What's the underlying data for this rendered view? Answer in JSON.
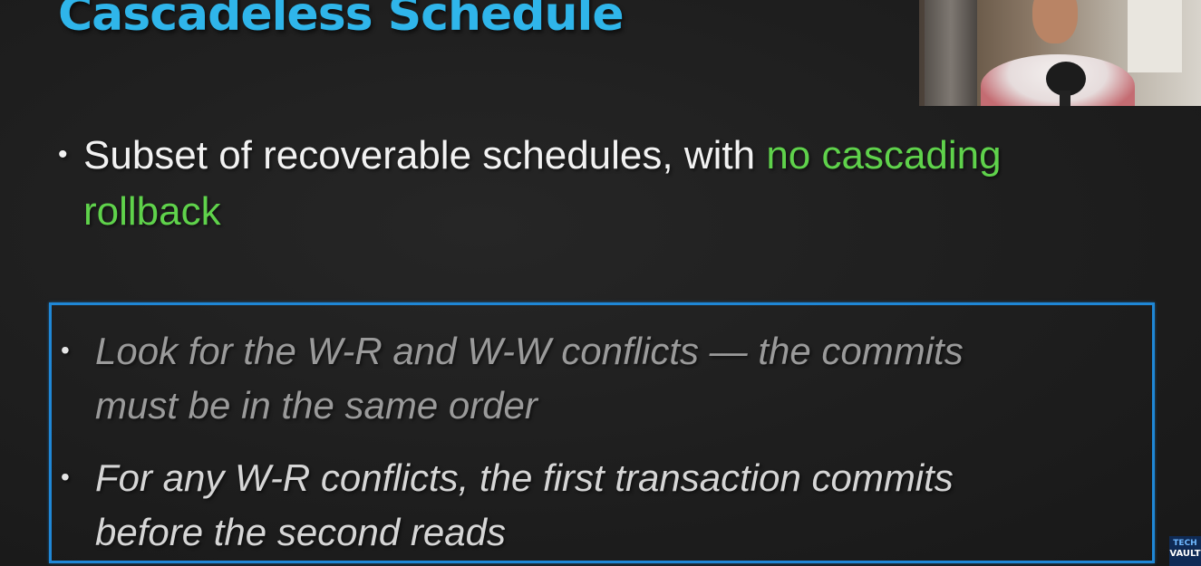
{
  "slide": {
    "title": "Cascadeless Schedule",
    "bullet": {
      "text": "Subset of recoverable schedules, with",
      "highlight_line1": "no cascading",
      "highlight_line2": "rollback"
    },
    "box_items": [
      {
        "line1": "Look for the W-R and W-W conflicts — the commits",
        "line2": "must be in the same order"
      },
      {
        "line1": "For any W-R conflicts, the first transaction commits",
        "line2": "before the second reads"
      }
    ],
    "bullet_glyph": "•"
  },
  "logo": {
    "line1": "TECH",
    "line2": "VAULT"
  },
  "colors": {
    "title": "#2fb5ea",
    "highlight": "#5fd24b",
    "box_border": "#1f87d6",
    "background": "#1f1f1f"
  }
}
